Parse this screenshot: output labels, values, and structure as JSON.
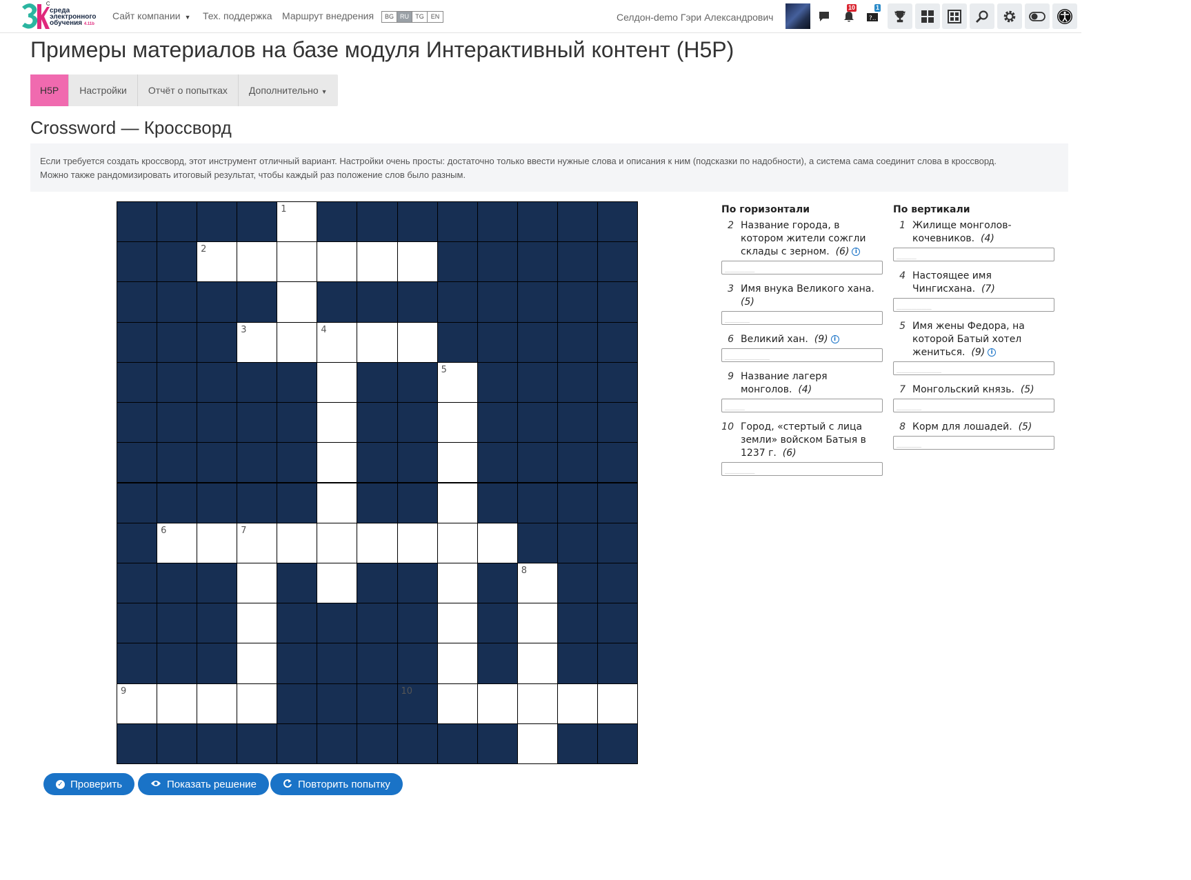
{
  "navbar": {
    "logo_text_line1": "среда",
    "logo_text_line2": "электронного",
    "logo_text_line3": "обучения",
    "logo_version": "4.11b",
    "links": [
      {
        "label": "Сайт компании",
        "has_caret": true
      },
      {
        "label": "Тех. поддержка",
        "has_caret": false
      },
      {
        "label": "Маршрут внедрения",
        "has_caret": false
      }
    ],
    "languages": [
      "BG",
      "RU",
      "TG",
      "EN"
    ],
    "active_language": "RU",
    "username": "Селдон-demo Гэри Александрович",
    "notifications_count": "10",
    "questions_count": "1"
  },
  "page": {
    "title": "Примеры материалов на базе модуля Интерактивный контент (H5P)",
    "tabs": [
      "H5P",
      "Настройки",
      "Отчёт о попытках",
      "Дополнительно"
    ],
    "active_tab": "H5P",
    "section_title": "Crossword — Кроссворд",
    "intro_line1": "Если требуется создать кроссворд, этот инструмент отличный вариант. Настройки очень просты: достаточно только ввести нужные слова и описания к ним (подсказки по надобности), а система сама соединит слова в кроссворд.",
    "intro_line2": "Можно также рандомизировать итоговый результат, чтобы каждый раз положение слов было разным."
  },
  "crossword": {
    "rows": 14,
    "cols": 13,
    "pattern": [
      "....W........",
      "..WWWWWW.....",
      "....W........",
      "...WWWWW.....",
      ".....W..W....",
      ".....W..W....",
      ".....W..W....",
      ".....W..W....",
      ".WWWWWWWWW...",
      "...W.W..W.W..",
      "...W....W.W..",
      "...W....W.W..",
      "WWWW....WWWWWW",
      "..........W.."
    ],
    "numbers": [
      {
        "row": 0,
        "col": 4,
        "n": "1"
      },
      {
        "row": 1,
        "col": 2,
        "n": "2"
      },
      {
        "row": 3,
        "col": 3,
        "n": "3"
      },
      {
        "row": 3,
        "col": 5,
        "n": "4"
      },
      {
        "row": 4,
        "col": 8,
        "n": "5"
      },
      {
        "row": 8,
        "col": 1,
        "n": "6"
      },
      {
        "row": 8,
        "col": 3,
        "n": "7"
      },
      {
        "row": 9,
        "col": 10,
        "n": "8"
      },
      {
        "row": 12,
        "col": 0,
        "n": "9"
      },
      {
        "row": 12,
        "col": 7,
        "n": "10"
      }
    ]
  },
  "clues": {
    "across_heading": "По горизонтали",
    "down_heading": "По вертикали",
    "across": [
      {
        "num": "2",
        "text": "Название города, в котором жители сожгли склады с зерном.",
        "len": "(6)",
        "hint": true,
        "placeholder": "______"
      },
      {
        "num": "3",
        "text": "Имя внука Великого хана.",
        "len": "(5)",
        "hint": false,
        "placeholder": "_____"
      },
      {
        "num": "6",
        "text": "Великий хан.",
        "len": "(9)",
        "hint": true,
        "placeholder": "_________"
      },
      {
        "num": "9",
        "text": "Название лагеря монголов.",
        "len": "(4)",
        "hint": false,
        "placeholder": "____"
      },
      {
        "num": "10",
        "text": "Город, «стертый с лица земли» войском Батыя в 1237 г.",
        "len": "(6)",
        "hint": false,
        "placeholder": "______"
      }
    ],
    "down": [
      {
        "num": "1",
        "text": "Жилище монголов-кочевников.",
        "len": "(4)",
        "hint": false,
        "placeholder": "____"
      },
      {
        "num": "4",
        "text": "Настоящее имя Чингисхана.",
        "len": "(7)",
        "hint": false,
        "placeholder": "_______"
      },
      {
        "num": "5",
        "text": "Имя жены Федора, на которой Батый хотел жениться.",
        "len": "(9)",
        "hint": true,
        "placeholder": "_________"
      },
      {
        "num": "7",
        "text": "Монгольский князь.",
        "len": "(5)",
        "hint": false,
        "placeholder": "_____"
      },
      {
        "num": "8",
        "text": "Корм для лошадей.",
        "len": "(5)",
        "hint": false,
        "placeholder": "_____"
      }
    ]
  },
  "buttons": {
    "check": "Проверить",
    "show_solution": "Показать решение",
    "retry": "Повторить попытку"
  },
  "colors": {
    "dark_cell": "#172f53",
    "accent_blue": "#1a73c7",
    "active_tab": "#f06aaf"
  }
}
